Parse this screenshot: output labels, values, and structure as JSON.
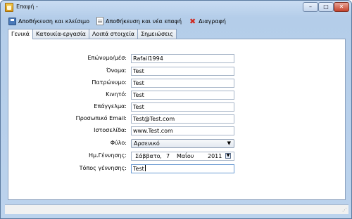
{
  "window": {
    "title": "Επαφή -"
  },
  "titlebar_buttons": {
    "minimize": "–",
    "maximize": "□",
    "close": "✕"
  },
  "toolbar": {
    "save_close_label": "Αποθήκευση και κλείσιμο",
    "save_new_label": "Αποθήκευση και νέα επαφή",
    "delete_label": "Διαγραφή"
  },
  "tabs": [
    {
      "label": "Γενικά",
      "active": true
    },
    {
      "label": "Κατοικία-εργασία",
      "active": false
    },
    {
      "label": "Λοιπά στοιχεία",
      "active": false
    },
    {
      "label": "Σημειώσεις",
      "active": false
    }
  ],
  "form": {
    "surname": {
      "label": "Επώνυμο/μέσ:",
      "value": "Rafail1994"
    },
    "name": {
      "label": "Όνομα:",
      "value": "Test"
    },
    "father": {
      "label": "Πατρώνυμο:",
      "value": "Test"
    },
    "mobile": {
      "label": "Κινητό:",
      "value": "Test"
    },
    "profession": {
      "label": "Επάγγελμα:",
      "value": "Test"
    },
    "email": {
      "label": "Προσωπικό Email:",
      "value": "Test@Test.com"
    },
    "website": {
      "label": "Ιστοσελίδα:",
      "value": "www.Test.com"
    },
    "gender": {
      "label": "Φύλο:",
      "value": "Αρσενικό"
    },
    "birthdate": {
      "label": "Ημ.Γέννησης:",
      "weekday": "Σάββατο",
      "sep": ",",
      "day": "7",
      "month": "Μαΐου",
      "year": "2011"
    },
    "birthplace": {
      "label": "Τόπος γέννησης:",
      "value": "Test"
    }
  },
  "icons": {
    "app": "contact-book-icon",
    "save": "floppy-disk-icon",
    "new": "document-icon",
    "delete": "red-x-icon",
    "calendar": "calendar-icon"
  },
  "colors": {
    "delete_icon": "#d0261c",
    "focus_border": "#6b9bd3"
  }
}
